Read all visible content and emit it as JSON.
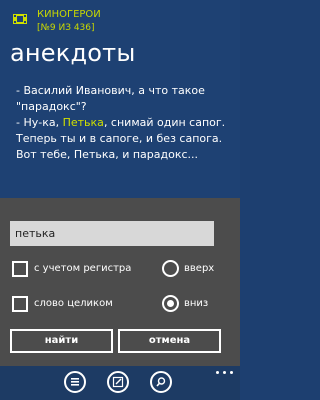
{
  "header": {
    "app_name": "КИНОГЕРОИ",
    "position": "[№9 ИЗ 436]",
    "page_title": "анекдоты"
  },
  "joke": {
    "line1": "- Василий Иванович, а что такое \"парадокс\"?",
    "line2_prefix": " - Ну-ка, ",
    "line2_highlight": "Петька",
    "line2_rest": ", снимай один сапог. Теперь ты и в сапоге, и без сапога. Вот тебе, Петька, и парадокс..."
  },
  "find_dialog": {
    "search_value": "петька",
    "match_case_label": "с учетом регистра",
    "whole_word_label": "слово целиком",
    "up_label": "вверх",
    "down_label": "вниз",
    "find_label": "найти",
    "cancel_label": "отмена",
    "match_case_checked": false,
    "whole_word_checked": false,
    "direction": "down"
  },
  "appbar": {
    "icons": [
      "list-icon",
      "edit-icon",
      "search-icon"
    ],
    "more": "more-icon"
  },
  "colors": {
    "background": "#1e4173",
    "accent": "#c9d800",
    "dialog": "#4c4c4c",
    "appbar": "#1d3b64"
  }
}
